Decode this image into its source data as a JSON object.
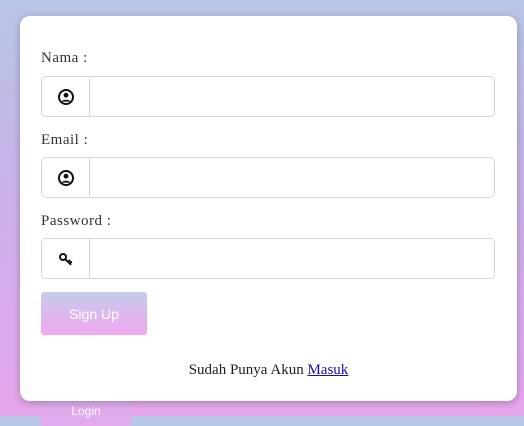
{
  "form": {
    "name_label": "Nama :",
    "email_label": "Email :",
    "password_label": "Password :",
    "name_value": "",
    "email_value": "",
    "password_value": "",
    "signup_label": "Sign Up",
    "footer_text": "Sudah Punya Akun",
    "footer_link": "Masuk",
    "icons": [
      "user-circle-icon",
      "user-circle-icon",
      "key-icon"
    ]
  },
  "background": {
    "partial_button_label": "Login"
  },
  "colors": {
    "button_gradient_top": "#c4cde9",
    "button_gradient_bottom": "#eeaaf0",
    "link": "#1a0dab"
  }
}
